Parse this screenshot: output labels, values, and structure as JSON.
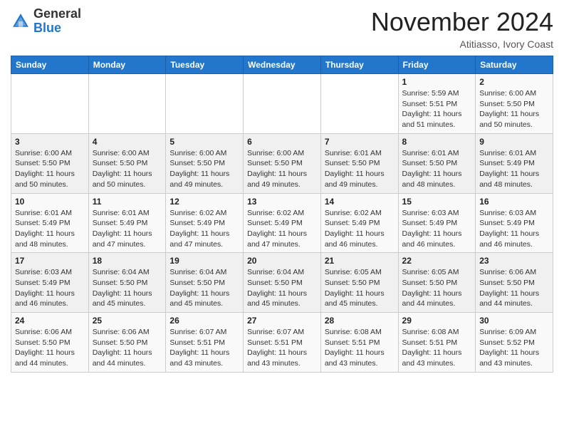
{
  "header": {
    "logo_line1": "General",
    "logo_line2": "Blue",
    "month": "November 2024",
    "location": "Atitiasso, Ivory Coast"
  },
  "weekdays": [
    "Sunday",
    "Monday",
    "Tuesday",
    "Wednesday",
    "Thursday",
    "Friday",
    "Saturday"
  ],
  "weeks": [
    [
      {
        "day": "",
        "info": ""
      },
      {
        "day": "",
        "info": ""
      },
      {
        "day": "",
        "info": ""
      },
      {
        "day": "",
        "info": ""
      },
      {
        "day": "",
        "info": ""
      },
      {
        "day": "1",
        "info": "Sunrise: 5:59 AM\nSunset: 5:51 PM\nDaylight: 11 hours\nand 51 minutes."
      },
      {
        "day": "2",
        "info": "Sunrise: 6:00 AM\nSunset: 5:50 PM\nDaylight: 11 hours\nand 50 minutes."
      }
    ],
    [
      {
        "day": "3",
        "info": "Sunrise: 6:00 AM\nSunset: 5:50 PM\nDaylight: 11 hours\nand 50 minutes."
      },
      {
        "day": "4",
        "info": "Sunrise: 6:00 AM\nSunset: 5:50 PM\nDaylight: 11 hours\nand 50 minutes."
      },
      {
        "day": "5",
        "info": "Sunrise: 6:00 AM\nSunset: 5:50 PM\nDaylight: 11 hours\nand 49 minutes."
      },
      {
        "day": "6",
        "info": "Sunrise: 6:00 AM\nSunset: 5:50 PM\nDaylight: 11 hours\nand 49 minutes."
      },
      {
        "day": "7",
        "info": "Sunrise: 6:01 AM\nSunset: 5:50 PM\nDaylight: 11 hours\nand 49 minutes."
      },
      {
        "day": "8",
        "info": "Sunrise: 6:01 AM\nSunset: 5:50 PM\nDaylight: 11 hours\nand 48 minutes."
      },
      {
        "day": "9",
        "info": "Sunrise: 6:01 AM\nSunset: 5:49 PM\nDaylight: 11 hours\nand 48 minutes."
      }
    ],
    [
      {
        "day": "10",
        "info": "Sunrise: 6:01 AM\nSunset: 5:49 PM\nDaylight: 11 hours\nand 48 minutes."
      },
      {
        "day": "11",
        "info": "Sunrise: 6:01 AM\nSunset: 5:49 PM\nDaylight: 11 hours\nand 47 minutes."
      },
      {
        "day": "12",
        "info": "Sunrise: 6:02 AM\nSunset: 5:49 PM\nDaylight: 11 hours\nand 47 minutes."
      },
      {
        "day": "13",
        "info": "Sunrise: 6:02 AM\nSunset: 5:49 PM\nDaylight: 11 hours\nand 47 minutes."
      },
      {
        "day": "14",
        "info": "Sunrise: 6:02 AM\nSunset: 5:49 PM\nDaylight: 11 hours\nand 46 minutes."
      },
      {
        "day": "15",
        "info": "Sunrise: 6:03 AM\nSunset: 5:49 PM\nDaylight: 11 hours\nand 46 minutes."
      },
      {
        "day": "16",
        "info": "Sunrise: 6:03 AM\nSunset: 5:49 PM\nDaylight: 11 hours\nand 46 minutes."
      }
    ],
    [
      {
        "day": "17",
        "info": "Sunrise: 6:03 AM\nSunset: 5:49 PM\nDaylight: 11 hours\nand 46 minutes."
      },
      {
        "day": "18",
        "info": "Sunrise: 6:04 AM\nSunset: 5:50 PM\nDaylight: 11 hours\nand 45 minutes."
      },
      {
        "day": "19",
        "info": "Sunrise: 6:04 AM\nSunset: 5:50 PM\nDaylight: 11 hours\nand 45 minutes."
      },
      {
        "day": "20",
        "info": "Sunrise: 6:04 AM\nSunset: 5:50 PM\nDaylight: 11 hours\nand 45 minutes."
      },
      {
        "day": "21",
        "info": "Sunrise: 6:05 AM\nSunset: 5:50 PM\nDaylight: 11 hours\nand 45 minutes."
      },
      {
        "day": "22",
        "info": "Sunrise: 6:05 AM\nSunset: 5:50 PM\nDaylight: 11 hours\nand 44 minutes."
      },
      {
        "day": "23",
        "info": "Sunrise: 6:06 AM\nSunset: 5:50 PM\nDaylight: 11 hours\nand 44 minutes."
      }
    ],
    [
      {
        "day": "24",
        "info": "Sunrise: 6:06 AM\nSunset: 5:50 PM\nDaylight: 11 hours\nand 44 minutes."
      },
      {
        "day": "25",
        "info": "Sunrise: 6:06 AM\nSunset: 5:50 PM\nDaylight: 11 hours\nand 44 minutes."
      },
      {
        "day": "26",
        "info": "Sunrise: 6:07 AM\nSunset: 5:51 PM\nDaylight: 11 hours\nand 43 minutes."
      },
      {
        "day": "27",
        "info": "Sunrise: 6:07 AM\nSunset: 5:51 PM\nDaylight: 11 hours\nand 43 minutes."
      },
      {
        "day": "28",
        "info": "Sunrise: 6:08 AM\nSunset: 5:51 PM\nDaylight: 11 hours\nand 43 minutes."
      },
      {
        "day": "29",
        "info": "Sunrise: 6:08 AM\nSunset: 5:51 PM\nDaylight: 11 hours\nand 43 minutes."
      },
      {
        "day": "30",
        "info": "Sunrise: 6:09 AM\nSunset: 5:52 PM\nDaylight: 11 hours\nand 43 minutes."
      }
    ]
  ]
}
